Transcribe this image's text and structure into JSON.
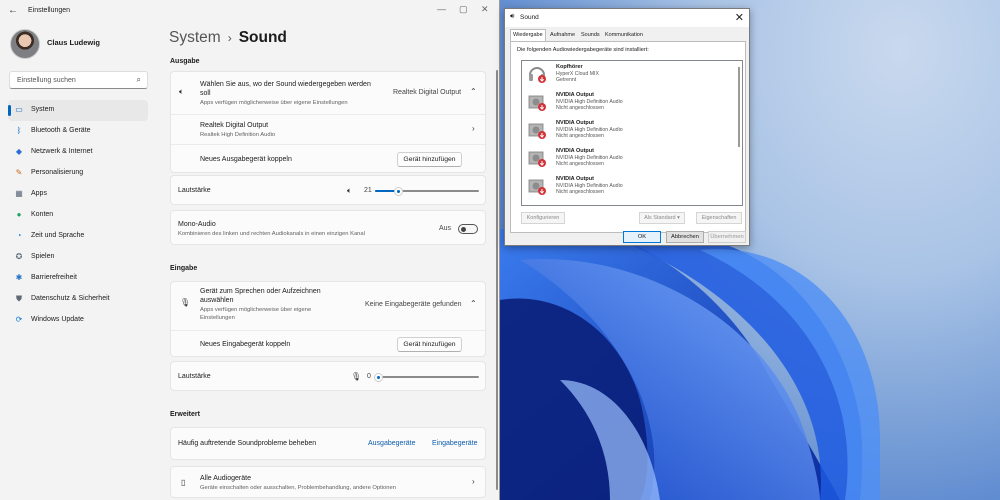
{
  "window": {
    "title": "Einstellungen",
    "back_icon": "back-arrow-icon"
  },
  "profile": {
    "name": "Claus Ludewig"
  },
  "search": {
    "placeholder": "Einstellung suchen"
  },
  "nav": {
    "items": [
      {
        "label": "System",
        "icon": "monitor-icon",
        "glyph": "▭",
        "color": "#0067c0",
        "active": true
      },
      {
        "label": "Bluetooth & Geräte",
        "icon": "bluetooth-icon",
        "glyph": "ᛒ",
        "color": "#0067c0"
      },
      {
        "label": "Netzwerk & Internet",
        "icon": "wifi-icon",
        "glyph": "◆",
        "color": "#2b6fd6"
      },
      {
        "label": "Personalisierung",
        "icon": "brush-icon",
        "glyph": "✎",
        "color": "#c8691c"
      },
      {
        "label": "Apps",
        "icon": "apps-icon",
        "glyph": "▦",
        "color": "#5a6a7a"
      },
      {
        "label": "Konten",
        "icon": "person-icon",
        "glyph": "●",
        "color": "#22a06b"
      },
      {
        "label": "Zeit und Sprache",
        "icon": "globe-clock-icon",
        "glyph": "◔",
        "color": "#0f7ad6"
      },
      {
        "label": "Spielen",
        "icon": "gamepad-icon",
        "glyph": "✪",
        "color": "#5d6f82"
      },
      {
        "label": "Barrierefreiheit",
        "icon": "accessibility-icon",
        "glyph": "✱",
        "color": "#1f6fc4"
      },
      {
        "label": "Datenschutz & Sicherheit",
        "icon": "shield-icon",
        "glyph": "⛊",
        "color": "#606a74"
      },
      {
        "label": "Windows Update",
        "icon": "update-icon",
        "glyph": "⟳",
        "color": "#0f7ad6"
      }
    ]
  },
  "breadcrumb": {
    "parent": "System",
    "current": "Sound"
  },
  "output": {
    "section": "Ausgabe",
    "choose_title": "Wählen Sie aus, wo der Sound wiedergegeben werden soll",
    "choose_title_l1": "Wählen Sie aus, wo der Sound wiedergegeben werden",
    "choose_title_l2": "soll",
    "choose_desc": "Apps verfügen möglicherweise über eigene Einstellungen",
    "choose_value": "Realtek Digital Output",
    "device_name": "Realtek Digital Output",
    "device_desc": "Realtek High Definition Audio",
    "pair_label": "Neues Ausgabegerät koppeln",
    "add_button": "Gerät hinzufügen",
    "volume_label": "Lautstärke",
    "volume_value": "21",
    "mono_title": "Mono-Audio",
    "mono_desc": "Kombinieren des linken und rechten Audiokanals in einen einzigen Kanal",
    "mono_state": "Aus"
  },
  "input": {
    "section": "Eingabe",
    "choose_title": "Gerät zum Sprechen oder Aufzeichnen auswählen",
    "choose_title_l1": "Gerät zum Sprechen oder Aufzeichnen",
    "choose_title_l2": "auswählen",
    "choose_desc": "Apps verfügen möglicherweise über eigene Einstellungen",
    "choose_desc_l1": "Apps verfügen möglicherweise über eigene",
    "choose_desc_l2": "Einstellungen",
    "choose_value": "Keine Eingabegeräte gefunden",
    "pair_label": "Neues Eingabegerät koppeln",
    "add_button": "Gerät hinzufügen",
    "volume_label": "Lautstärke",
    "volume_value": "0"
  },
  "advanced": {
    "section": "Erweitert",
    "troubleshoot_label": "Häufig auftretende Soundprobleme beheben",
    "link_output": "Ausgabegeräte",
    "link_input": "Eingabegeräte",
    "all_devices_title": "Alle Audiogeräte",
    "all_devices_desc": "Geräte einschalten oder ausschalten, Problembehandlung, andere Optionen"
  },
  "sound_dialog": {
    "title": "Sound",
    "tabs": [
      "Wiedergabe",
      "Aufnahme",
      "Sounds",
      "Kommunikation"
    ],
    "intro": "Die folgenden Audiowiedergabegeräte sind installiert:",
    "devices": [
      {
        "name": "Kopfhörer",
        "desc": "HyperX Cloud MIX",
        "status": "Getrennt",
        "icon": "headphones-icon"
      },
      {
        "name": "NVIDIA Output",
        "desc": "NVIDIA High Definition Audio",
        "status": "Nicht angeschlossen",
        "icon": "speaker-icon"
      },
      {
        "name": "NVIDIA Output",
        "desc": "NVIDIA High Definition Audio",
        "status": "Nicht angeschlossen",
        "icon": "speaker-icon"
      },
      {
        "name": "NVIDIA Output",
        "desc": "NVIDIA High Definition Audio",
        "status": "Nicht angeschlossen",
        "icon": "speaker-icon"
      },
      {
        "name": "NVIDIA Output",
        "desc": "NVIDIA High Definition Audio",
        "status": "Nicht angeschlossen",
        "icon": "speaker-icon"
      }
    ],
    "btn_configure": "Konfigurieren",
    "btn_default": "Als Standard",
    "btn_properties": "Eigenschaften",
    "btn_ok": "OK",
    "btn_cancel": "Abbrechen",
    "btn_apply": "Übernehmen"
  },
  "colors": {
    "accent": "#0067c0",
    "link": "#0b5cad",
    "status_disconnected": "#d13438"
  }
}
